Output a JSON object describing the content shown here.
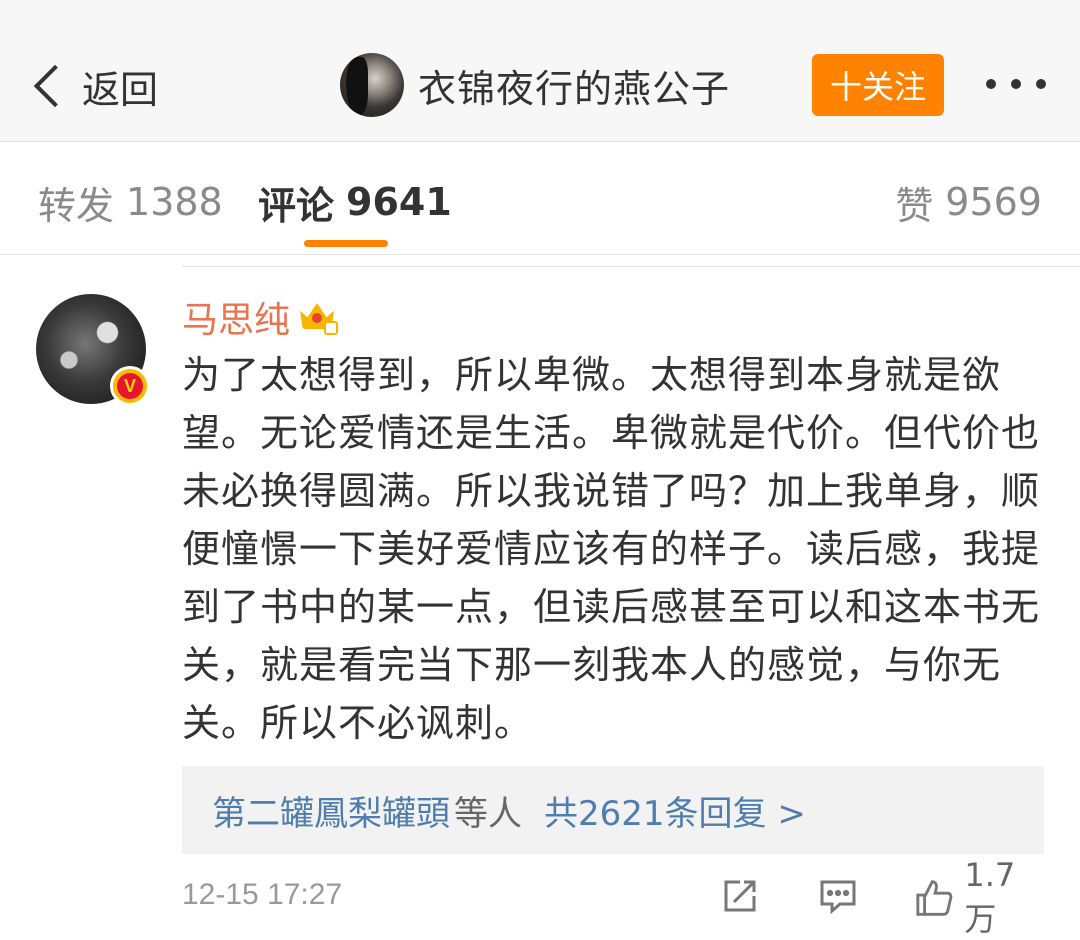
{
  "nav": {
    "back_label": "返回",
    "username": "衣锦夜行的燕公子",
    "follow_label": "十关注"
  },
  "tabs": {
    "repost": {
      "label": "转发",
      "count": "1388"
    },
    "comment": {
      "label": "评论",
      "count": "9641"
    },
    "like": {
      "label": "赞",
      "count": "9569"
    }
  },
  "comment": {
    "author": "马思纯",
    "text": "为了太想得到，所以卑微。太想得到本身就是欲望。无论爱情还是生活。卑微就是代价。但代价也未必换得圆满。所以我说错了吗？加上我单身，顺便憧憬一下美好爱情应该有的样子。读后感，我提到了书中的某一点，但读后感甚至可以和这本书无关，就是看完当下那一刻我本人的感觉，与你无关。所以不必讽刺。",
    "replies": {
      "names": "第二罐鳳梨罐頭",
      "others": "等人",
      "count_label": "共2621条回复 >"
    },
    "time": "12-15 17:27",
    "like_count": "1.7万",
    "verified_badge": "V"
  },
  "colors": {
    "accent": "#ff8200",
    "author_name": "#eb7350",
    "link_blue": "#507daf"
  },
  "icons": [
    "back-chevron-icon",
    "more-icon",
    "crown-icon",
    "verified-icon",
    "share-icon",
    "comment-icon",
    "like-icon"
  ]
}
